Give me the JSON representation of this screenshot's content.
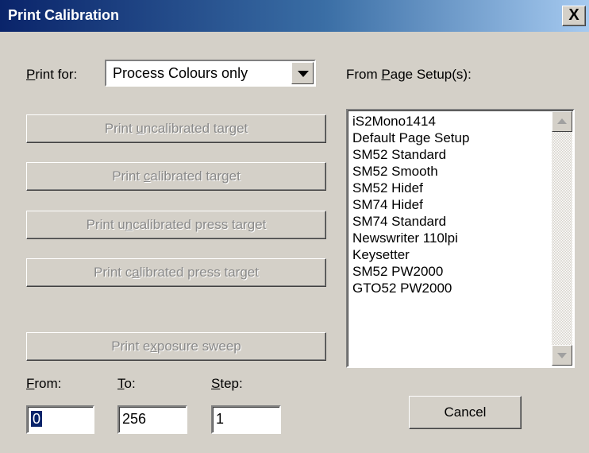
{
  "window": {
    "title": "Print Calibration",
    "close_label": "X"
  },
  "print_for": {
    "label_underline": "P",
    "label_rest": "rint for:",
    "selected": "Process Colours only"
  },
  "buttons": [
    {
      "pre": "Print ",
      "u": "u",
      "post": "ncalibrated target"
    },
    {
      "pre": "Print ",
      "u": "c",
      "post": "alibrated target"
    },
    {
      "pre": "Print u",
      "u": "n",
      "post": "calibrated press target"
    },
    {
      "pre": "Print c",
      "u": "a",
      "post": "librated press target"
    },
    {
      "pre": "Print e",
      "u": "x",
      "post": "posure sweep"
    }
  ],
  "page_setups": {
    "label_pre": "From ",
    "label_u": "P",
    "label_post": "age Setup(s):",
    "items": [
      "iS2Mono1414",
      "Default Page Setup",
      "SM52 Standard",
      "SM52 Smooth",
      "SM52 Hidef",
      "SM74 Hidef",
      "SM74 Standard",
      "Newswriter 110lpi",
      "Keysetter",
      "SM52 PW2000",
      "GTO52 PW2000"
    ]
  },
  "range": {
    "from": {
      "u": "F",
      "rest": "rom:",
      "value": "0"
    },
    "to": {
      "u": "T",
      "rest": "o:",
      "value": "256"
    },
    "step": {
      "u": "S",
      "rest": "tep:",
      "value": "1"
    }
  },
  "cancel_label": "Cancel"
}
